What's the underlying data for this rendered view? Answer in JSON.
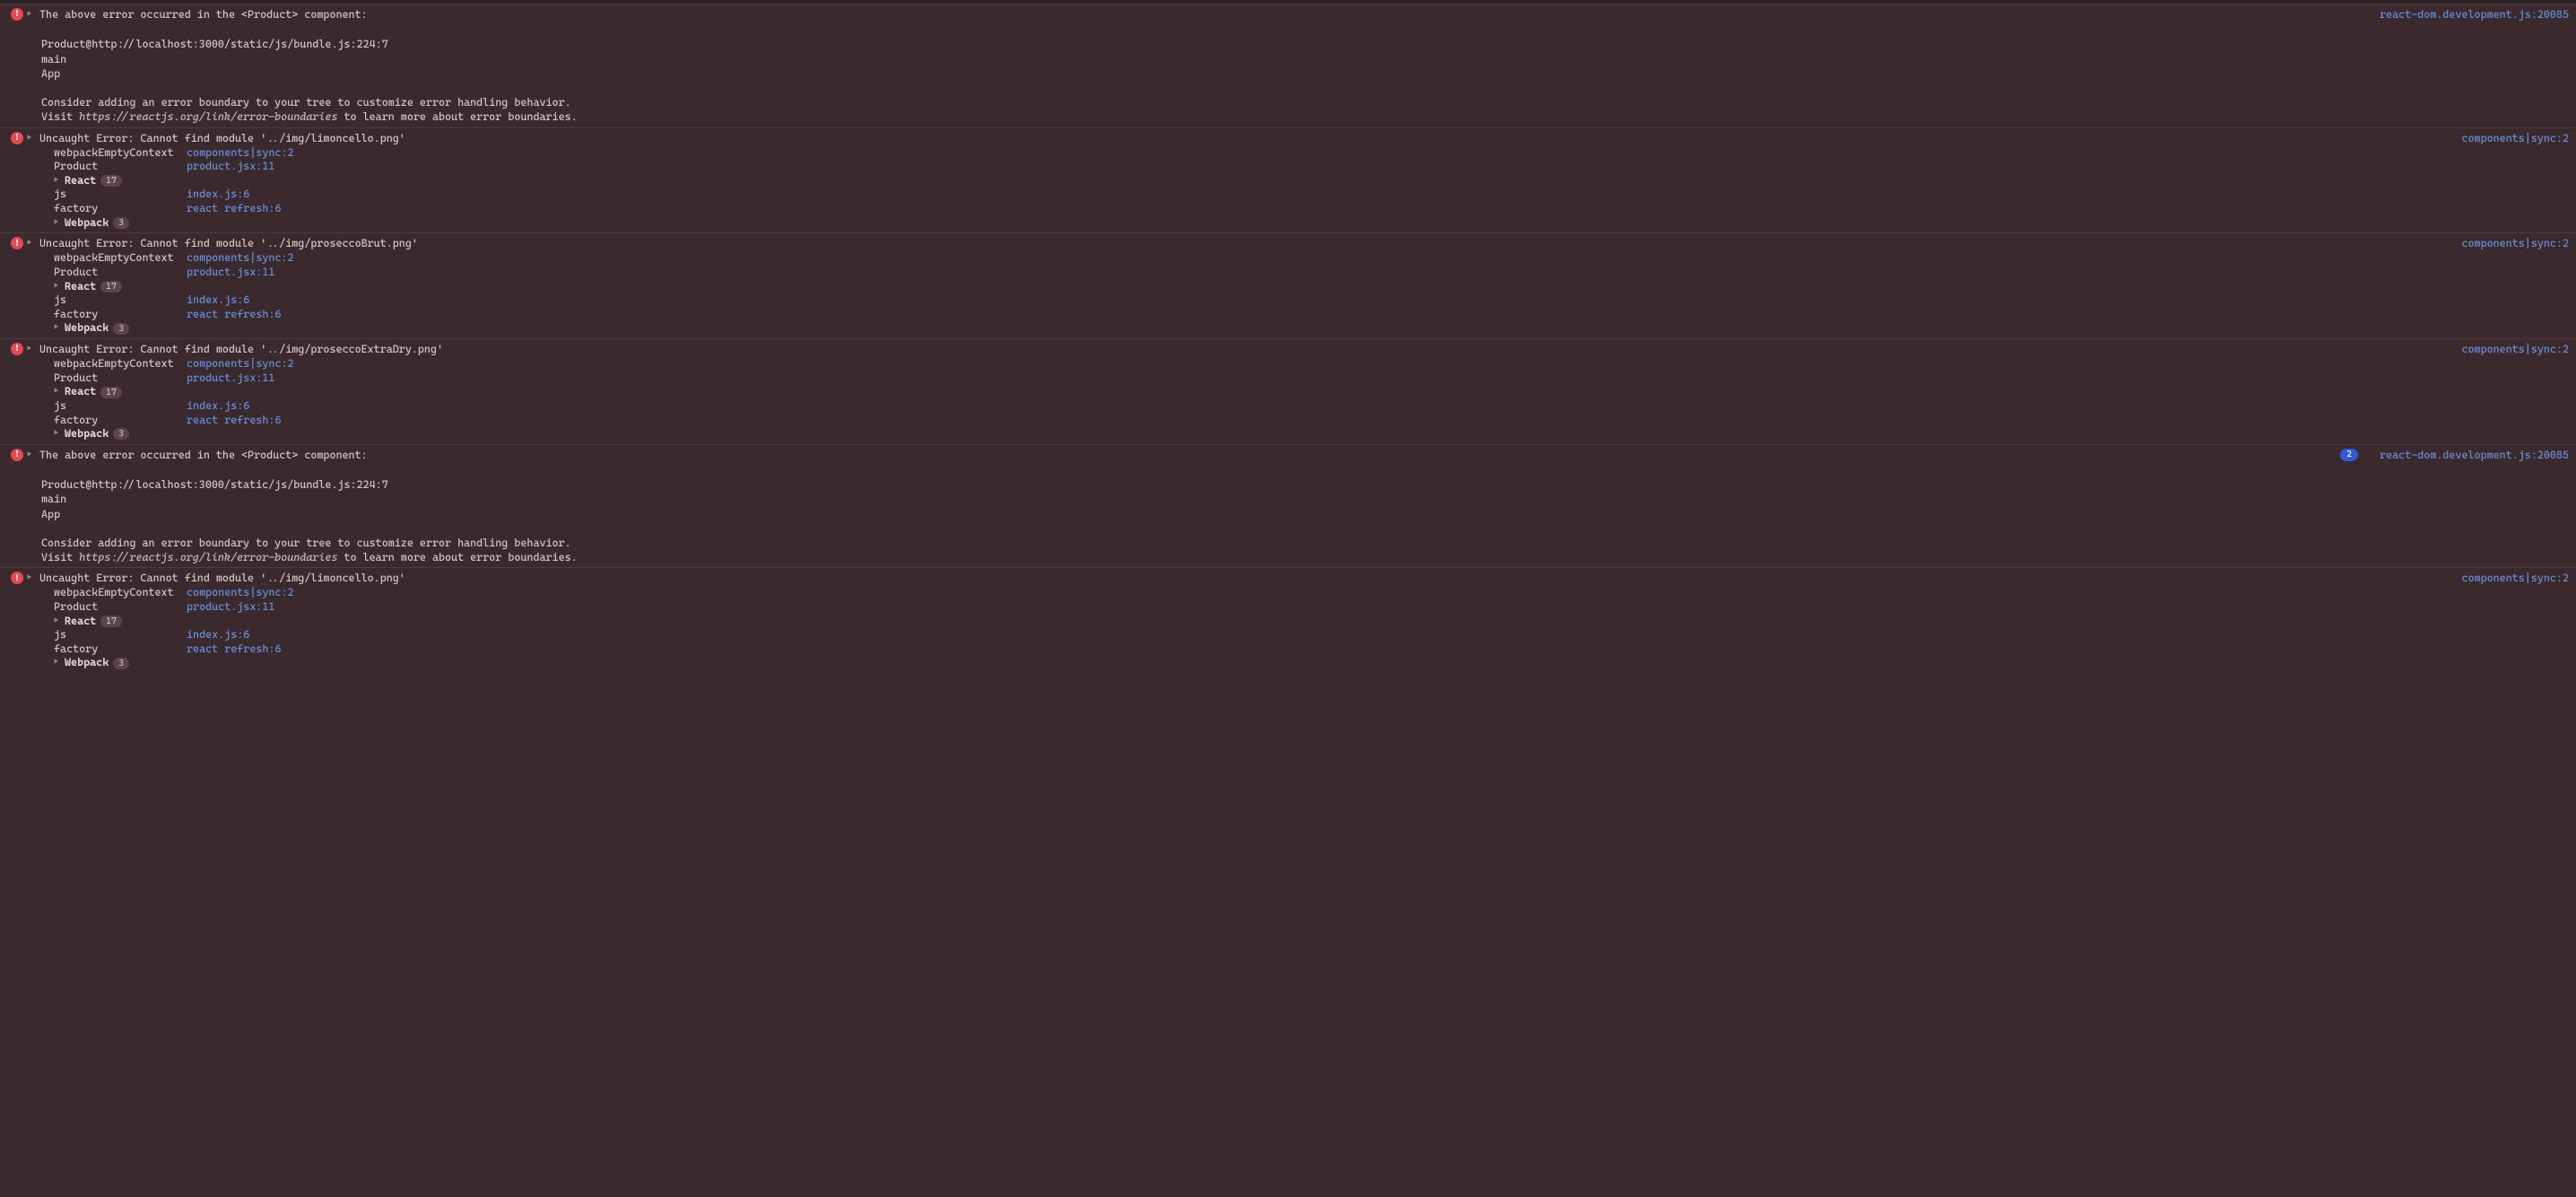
{
  "location_react_dom": "react-dom.development.js:20085",
  "location_components": "components|sync:2",
  "react_label": "React",
  "react_count": "17",
  "webpack_label": "Webpack",
  "webpack_count": "3",
  "stack_rows": {
    "webpackEmptyContext": {
      "label": "webpackEmptyContext",
      "loc": "components|sync:2"
    },
    "Product": {
      "label": "Product",
      "loc": "product.jsx:11"
    },
    "js": {
      "label": "js",
      "loc": "index.js:6"
    },
    "factory": {
      "label": "factory",
      "loc": "react refresh:6"
    }
  },
  "boundary_msg": {
    "title": "The above error occurred in the <Product> component:",
    "line1": "Product@http://localhost:3000/static/js/bundle.js:224:7",
    "line2": "main",
    "line3": "App",
    "line4": "Consider adding an error boundary to your tree to customize error handling behavior.",
    "line5a": "Visit ",
    "line5b": "https://reactjs.org/link/error-boundaries",
    "line5c": " to learn more about error boundaries."
  },
  "entries": [
    {
      "type": "boundary",
      "count": null
    },
    {
      "type": "module_err",
      "file": "'../img/limoncello.png'"
    },
    {
      "type": "module_err",
      "file": "'../img/proseccoBrut.png'"
    },
    {
      "type": "module_err",
      "file": "'../img/proseccoExtraDry.png'"
    },
    {
      "type": "boundary",
      "count": "2"
    },
    {
      "type": "module_err",
      "file": "'../img/limoncello.png'"
    }
  ],
  "module_err_prefix": "Uncaught Error: Cannot find module "
}
